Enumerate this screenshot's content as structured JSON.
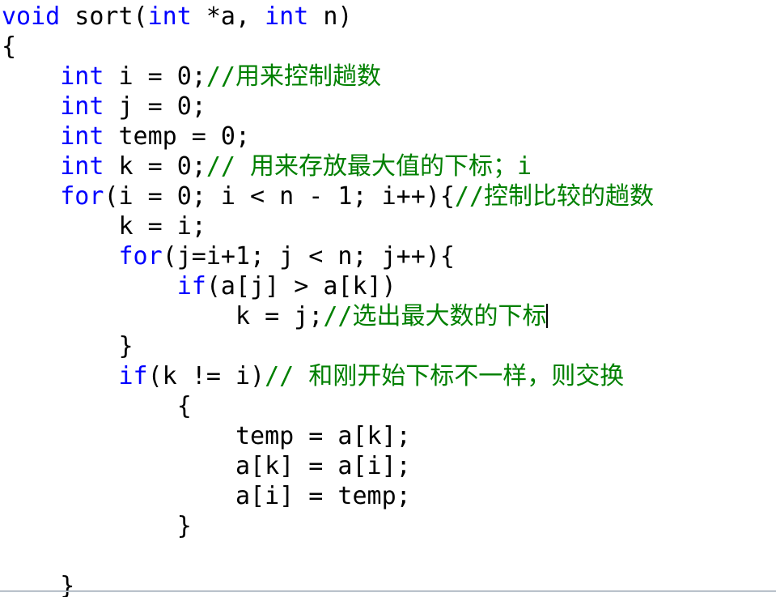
{
  "editor": {
    "language": "C",
    "background_color": "#ffffff",
    "keyword_color": "#0000ff",
    "code_color": "#000000",
    "comment_color": "#008000",
    "caret_color": "#000000",
    "divider_color": "#9aa4b0"
  },
  "code": {
    "lines": [
      {
        "indent": "",
        "tokens": [
          {
            "type": "kw",
            "text": "void"
          },
          {
            "type": "plain",
            "text": " sort("
          },
          {
            "type": "kw",
            "text": "int"
          },
          {
            "type": "plain",
            "text": " *a, "
          },
          {
            "type": "kw",
            "text": "int"
          },
          {
            "type": "plain",
            "text": " n)"
          }
        ]
      },
      {
        "indent": "",
        "tokens": [
          {
            "type": "plain",
            "text": "{"
          }
        ]
      },
      {
        "indent": "    ",
        "tokens": [
          {
            "type": "kw",
            "text": "int"
          },
          {
            "type": "plain",
            "text": " i = 0;"
          },
          {
            "type": "comment",
            "text": "//用来控制趟数"
          }
        ]
      },
      {
        "indent": "    ",
        "tokens": [
          {
            "type": "kw",
            "text": "int"
          },
          {
            "type": "plain",
            "text": " j = 0;"
          }
        ]
      },
      {
        "indent": "    ",
        "tokens": [
          {
            "type": "kw",
            "text": "int"
          },
          {
            "type": "plain",
            "text": " temp = 0;"
          }
        ]
      },
      {
        "indent": "    ",
        "tokens": [
          {
            "type": "kw",
            "text": "int"
          },
          {
            "type": "plain",
            "text": " k = 0;"
          },
          {
            "type": "comment",
            "text": "// 用来存放最大值的下标；i"
          }
        ]
      },
      {
        "indent": "    ",
        "tokens": [
          {
            "type": "kw",
            "text": "for"
          },
          {
            "type": "plain",
            "text": "(i = 0; i < n - 1; i++){"
          },
          {
            "type": "comment",
            "text": "//控制比较的趟数"
          }
        ]
      },
      {
        "indent": "        ",
        "tokens": [
          {
            "type": "plain",
            "text": "k = i;"
          }
        ]
      },
      {
        "indent": "        ",
        "tokens": [
          {
            "type": "kw",
            "text": "for"
          },
          {
            "type": "plain",
            "text": "(j=i+1; j < n; j++){"
          }
        ]
      },
      {
        "indent": "            ",
        "tokens": [
          {
            "type": "kw",
            "text": "if"
          },
          {
            "type": "plain",
            "text": "(a[j] > a[k])"
          }
        ]
      },
      {
        "indent": "                ",
        "tokens": [
          {
            "type": "plain",
            "text": "k = j;"
          },
          {
            "type": "comment",
            "text": "//选出最大数的下标"
          },
          {
            "type": "caret",
            "text": ""
          }
        ]
      },
      {
        "indent": "        ",
        "tokens": [
          {
            "type": "plain",
            "text": "}"
          }
        ]
      },
      {
        "indent": "        ",
        "tokens": [
          {
            "type": "kw",
            "text": "if"
          },
          {
            "type": "plain",
            "text": "(k != i)"
          },
          {
            "type": "comment",
            "text": "// 和刚开始下标不一样，则交换"
          }
        ]
      },
      {
        "indent": "            ",
        "tokens": [
          {
            "type": "plain",
            "text": "{"
          }
        ]
      },
      {
        "indent": "                ",
        "tokens": [
          {
            "type": "plain",
            "text": "temp = a[k];"
          }
        ]
      },
      {
        "indent": "                ",
        "tokens": [
          {
            "type": "plain",
            "text": "a[k] = a[i];"
          }
        ]
      },
      {
        "indent": "                ",
        "tokens": [
          {
            "type": "plain",
            "text": "a[i] = temp;"
          }
        ]
      },
      {
        "indent": "            ",
        "tokens": [
          {
            "type": "plain",
            "text": "}"
          }
        ]
      },
      {
        "indent": "",
        "tokens": []
      },
      {
        "indent": "    ",
        "tokens": [
          {
            "type": "plain",
            "text": "}"
          }
        ]
      }
    ]
  }
}
